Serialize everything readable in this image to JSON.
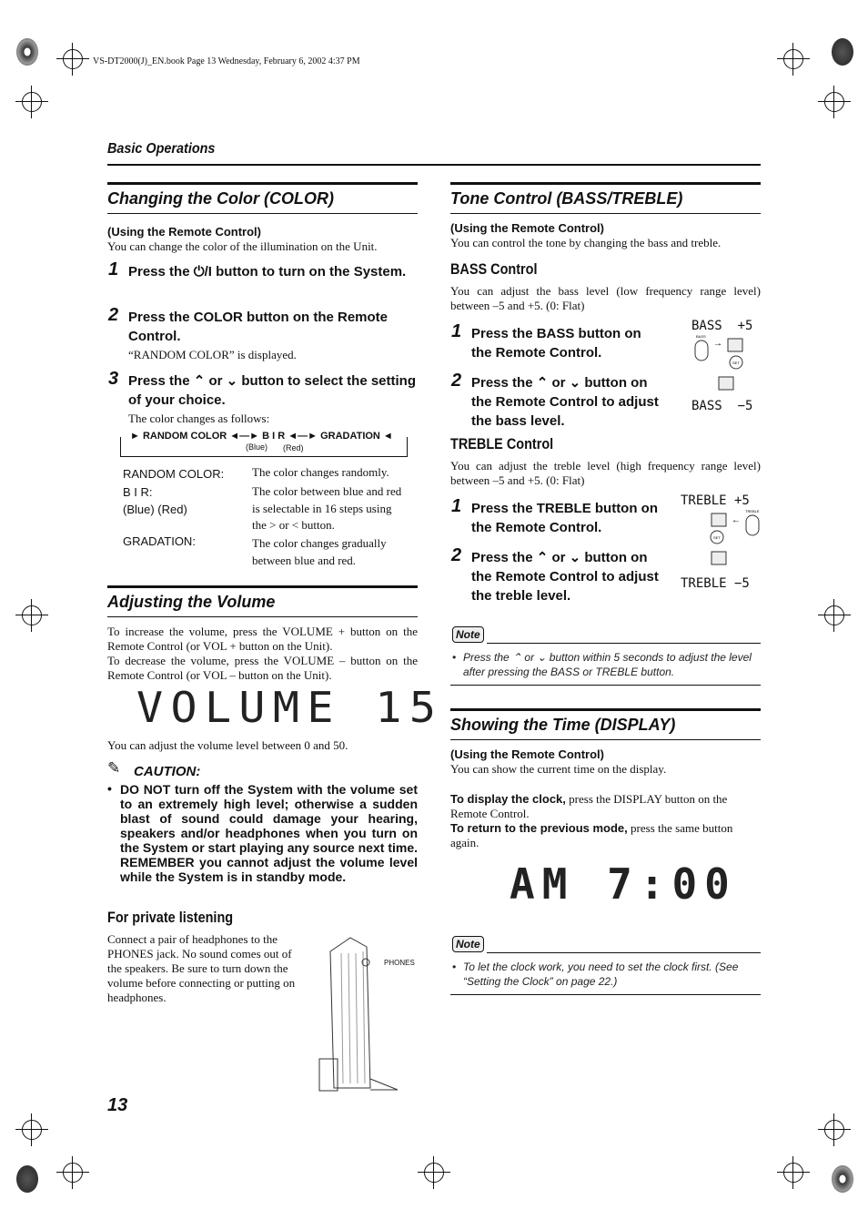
{
  "header": {
    "book_info": "VS-DT2000(J)_EN.book  Page 13  Wednesday, February 6, 2002  4:37 PM",
    "section": "Basic Operations"
  },
  "page_number": "13",
  "color": {
    "title": "Changing the Color (COLOR)",
    "using": "(Using the Remote Control)",
    "intro": "You can change the color of the illumination on the Unit.",
    "steps": [
      {
        "n": "1",
        "text": "Press the ⏻/I button to turn on the System."
      },
      {
        "n": "2",
        "text": "Press the COLOR button on the Remote Control.",
        "sub": "“RANDOM COLOR” is displayed."
      },
      {
        "n": "3",
        "text": "Press the ⌃ or ⌄ button to select the setting of your choice.",
        "sub": "The color changes as follows:"
      }
    ],
    "flow": {
      "a": "RANDOM COLOR",
      "b": "B I R",
      "c": "GRADATION",
      "blue": "(Blue)",
      "red": "(Red)"
    },
    "defs": [
      {
        "term": "RANDOM COLOR:",
        "desc": "The color changes randomly."
      },
      {
        "term": "B I R:\n(Blue) (Red)",
        "desc": "The color between blue and red is selectable in 16 steps using the > or < button."
      },
      {
        "term": "GRADATION:",
        "desc": "The color changes gradually between blue and red."
      }
    ]
  },
  "volume": {
    "title": "Adjusting the Volume",
    "p1": "To increase the volume, press the VOLUME + button on the Remote Control (or VOL + button on the Unit).",
    "p2": "To decrease the volume, press the VOLUME – button on the Remote Control (or VOL – button on the Unit).",
    "display": "VOLUME 15",
    "range": "You can adjust the volume level between 0 and 50.",
    "caution_title": "CAUTION:",
    "caution": "DO NOT turn off the System with the volume set to an extremely high level; otherwise a sudden blast of sound could damage your hearing, speakers and/or headphones when you turn on the System or start playing any source next time. REMEMBER you cannot adjust the volume level while the System is in standby mode.",
    "private_title": "For private listening",
    "private_text": "Connect a pair of headphones to the PHONES jack. No sound comes out of the speakers. Be sure to turn down the volume before connecting or putting on headphones.",
    "phones_label": "PHONES"
  },
  "tone": {
    "title": "Tone Control (BASS/TREBLE)",
    "using": "(Using the Remote Control)",
    "intro": "You can control the tone by changing the bass and treble.",
    "bass": {
      "title": "BASS Control",
      "text": "You can adjust the bass level (low frequency range level) between –5 and +5. (0: Flat)",
      "steps": [
        {
          "n": "1",
          "text": "Press the BASS button on the Remote Control."
        },
        {
          "n": "2",
          "text": "Press the ⌃ or ⌄ button on the Remote Control to adjust the bass level."
        }
      ],
      "disp_hi": "BASS  +5",
      "disp_lo": "BASS  −5",
      "btn": "BASS",
      "set": "SET"
    },
    "treble": {
      "title": "TREBLE Control",
      "text": "You can adjust the treble level (high frequency range level) between –5 and +5. (0: Flat)",
      "steps": [
        {
          "n": "1",
          "text": "Press the TREBLE button on the Remote Control."
        },
        {
          "n": "2",
          "text": "Press the ⌃ or ⌄ button on the Remote Control to adjust the treble level."
        }
      ],
      "disp_hi": "TREBLE +5",
      "disp_lo": "TREBLE −5",
      "btn": "TREBLE",
      "set": "SET"
    },
    "note_label": "Note",
    "note": "Press the ⌃ or ⌄ button within 5 seconds to adjust the level after pressing the BASS or TREBLE button."
  },
  "display": {
    "title": "Showing the Time (DISPLAY)",
    "using": "(Using the Remote Control)",
    "intro": "You can show the current time on the display.",
    "p1_bold": "To display the clock,",
    "p1": " press the DISPLAY button on the Remote Control.",
    "p2_bold": "To return to the previous mode,",
    "p2": " press the same button again.",
    "clock": "AM 7:00",
    "note_label": "Note",
    "note": "To let the clock work, you need to set the clock first. (See “Setting the Clock” on page 22.)"
  }
}
